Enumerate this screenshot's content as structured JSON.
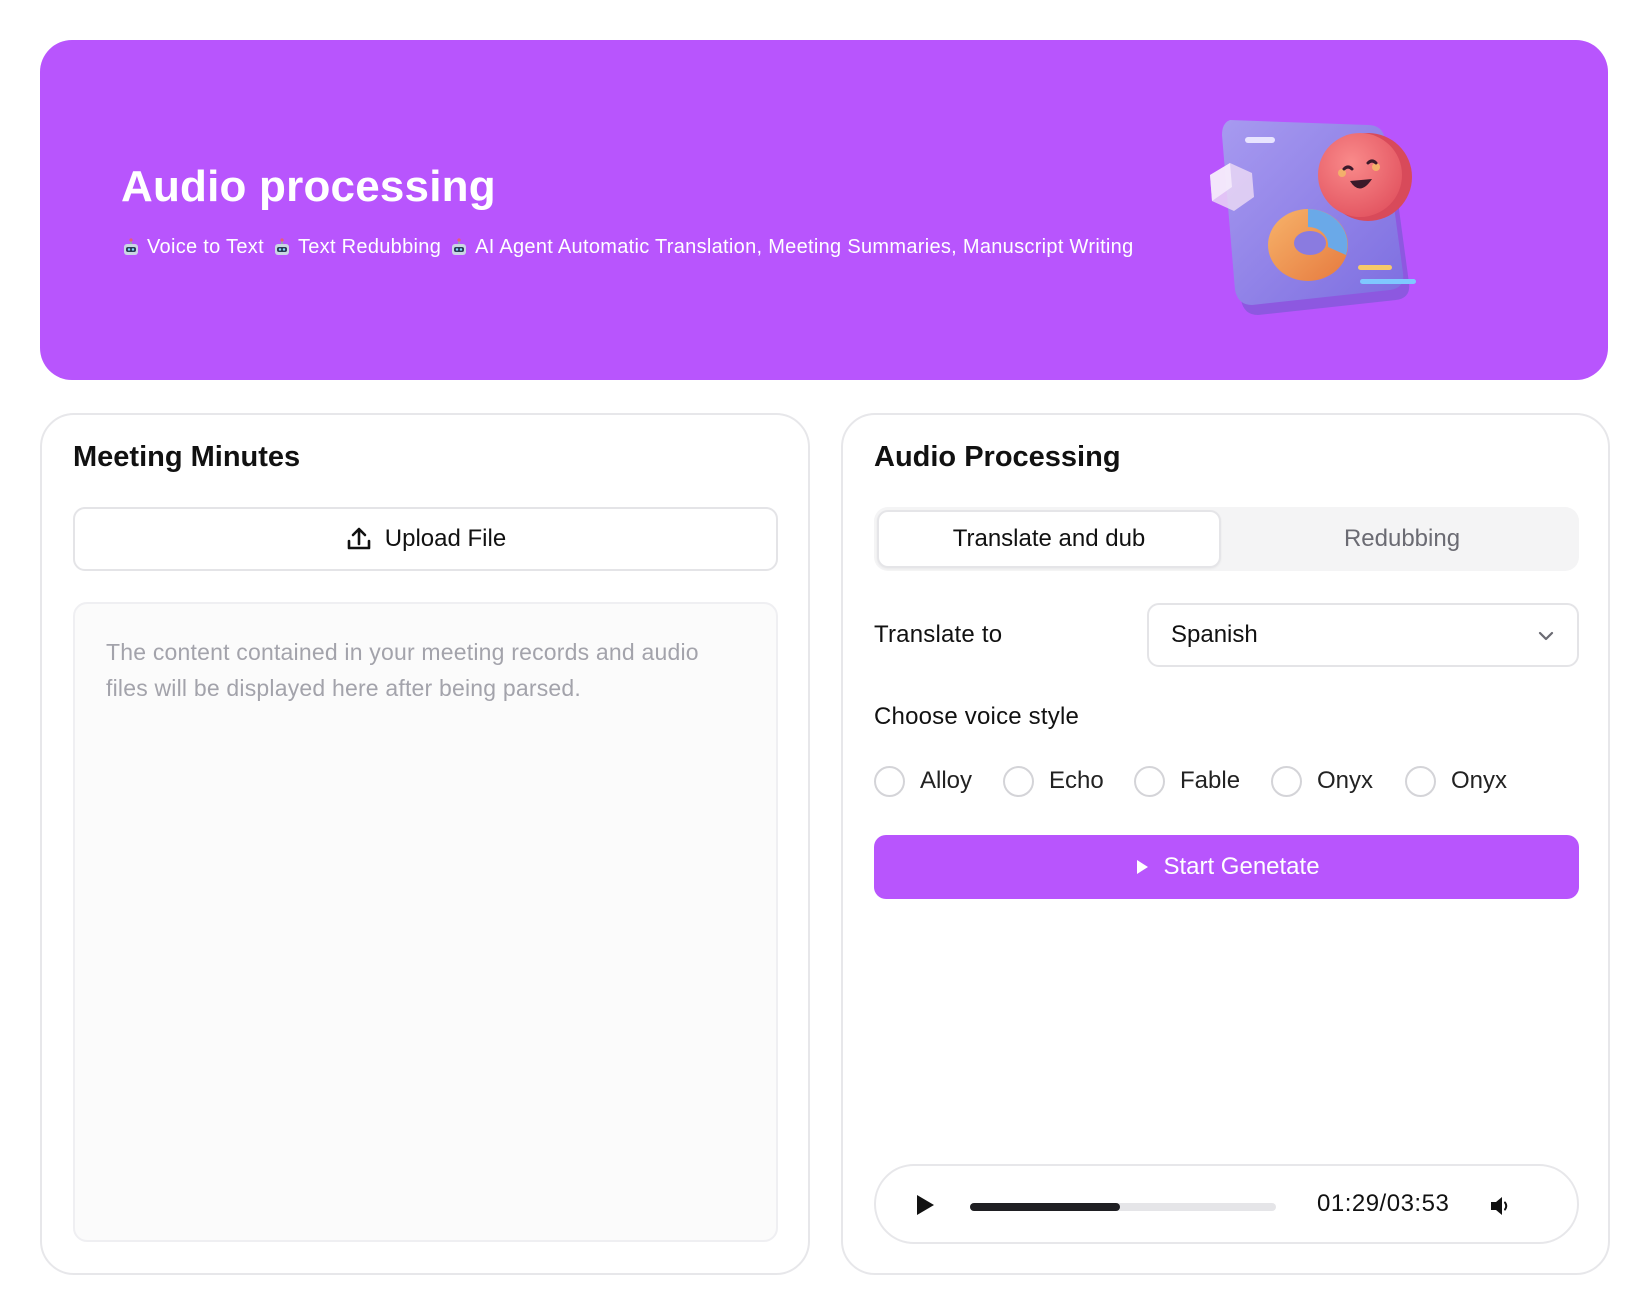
{
  "hero": {
    "title": "Audio processing",
    "subtitle_parts": [
      "Voice to Text",
      "Text Redubbing",
      "AI Agent Automatic Translation, Meeting Summaries, Manuscript Writing"
    ],
    "accent_color": "#b855fd"
  },
  "meeting_minutes": {
    "title": "Meeting Minutes",
    "upload_label": "Upload File",
    "placeholder": "The content contained in your meeting records and audio files will be displayed here after being parsed."
  },
  "audio_processing": {
    "title": "Audio Processing",
    "tabs": [
      {
        "label": "Translate and dub",
        "active": true
      },
      {
        "label": "Redubbing",
        "active": false
      }
    ],
    "translate_label": "Translate to",
    "translate_value": "Spanish",
    "voice_style_label": "Choose voice style",
    "voices": [
      "Alloy",
      "Echo",
      "Fable",
      "Onyx",
      "Onyx"
    ],
    "generate_label": "Start Genetate",
    "player": {
      "time": "01:29/03:53",
      "progress_fraction": 0.49
    }
  },
  "icons": [
    "robot-icon",
    "upload-icon",
    "chevron-down-icon",
    "play-icon",
    "volume-icon"
  ]
}
